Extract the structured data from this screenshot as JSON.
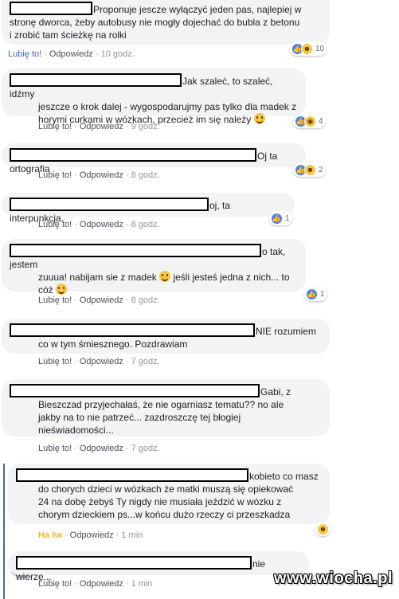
{
  "comments": [
    {
      "text_lines": [
        "Proponuje jescze wyłączyć jeden pas, najlepiej w",
        "stronę dworca, żeby autobusy nie mogły dojechać do bubla z betonu",
        "i zrobić tam ścieżkę na rolki"
      ],
      "like_label": "Lubię to!",
      "reply_label": "Odpowiedz",
      "time": "10 godz.",
      "reaction_icons": [
        "like-icon",
        "haha-icon"
      ],
      "reaction_count": "10"
    },
    {
      "text_lines": [
        "Jak szaleć, to szaleć, idźmy",
        "jeszcze o krok dalej - wygospodarujmy pas tylko dla madek z",
        "horymi curkami w wózkach, przecież im się należy"
      ],
      "like_label": "Lubię to!",
      "reply_label": "Odpowiedz",
      "time": "9 godz.",
      "reaction_icons": [
        "like-icon",
        "wow-icon"
      ],
      "reaction_count": "4"
    },
    {
      "text_lines": [
        "Oj ta ortografia"
      ],
      "like_label": "Lubię to!",
      "reply_label": "Odpowiedz",
      "time": "8 godz.",
      "reaction_icons": [
        "like-icon",
        "haha-icon"
      ],
      "reaction_count": "2"
    },
    {
      "text_lines": [
        "oj, ta interpunkcja."
      ],
      "like_label": "Lubię to!",
      "reply_label": "Odpowiedz",
      "time": "8 godz.",
      "reaction_icons": [
        "like-icon"
      ],
      "reaction_count": "1"
    },
    {
      "text_lines": [
        "o tak, jestem",
        "zuuua! nabijam sie z madek",
        "jeśli jesteś jedna z nich... to",
        "cóż"
      ],
      "like_label": "Lubię to!",
      "reply_label": "Odpowiedz",
      "time": "8 godz.",
      "reaction_icons": [
        "like-icon"
      ],
      "reaction_count": "1"
    },
    {
      "text_lines": [
        "NIE rozumiem",
        "co w tym śmiesznego. Pozdrawiam"
      ],
      "like_label": "Lubię to!",
      "reply_label": "Odpowiedz",
      "time": "7 godz."
    },
    {
      "text_lines": [
        "Gabi, z",
        "Bieszczad przyjechałaś, że nie ogarniasz tematu?? no ale",
        "jakby na to nie patrzeć... zazdroszczę tej błogiej",
        "nieświadomości..."
      ],
      "like_label": "Lubię to!",
      "reply_label": "Odpowiedz",
      "time": "7 godz."
    },
    {
      "text_lines": [
        "kobieto co masz",
        "do chorych dzieci w wózkach że matki muszą się opiekować",
        "24 na dobę żebyś Ty nigdy nie musiała jeździć w wózku z",
        "chorym dzieckiem ps...w końcu dużo rzeczy ci przeszkadza"
      ],
      "like_label": "Ha ha",
      "reply_label": "Odpowiedz",
      "time": "1 min",
      "reaction_icons": [
        "haha-icon"
      ]
    },
    {
      "text_lines": [
        "nie wierzę..."
      ],
      "like_label": "Lubię to!",
      "reply_label": "Odpowiedz",
      "time": "1 min"
    }
  ],
  "dot": "·",
  "watermark": "www.wiocha.pl",
  "colors": {
    "link_blue": "#4267b2",
    "bubble_bg": "#f2f3f5",
    "meta_gray": "#90949c",
    "haha_yellow": "#f7b125"
  }
}
